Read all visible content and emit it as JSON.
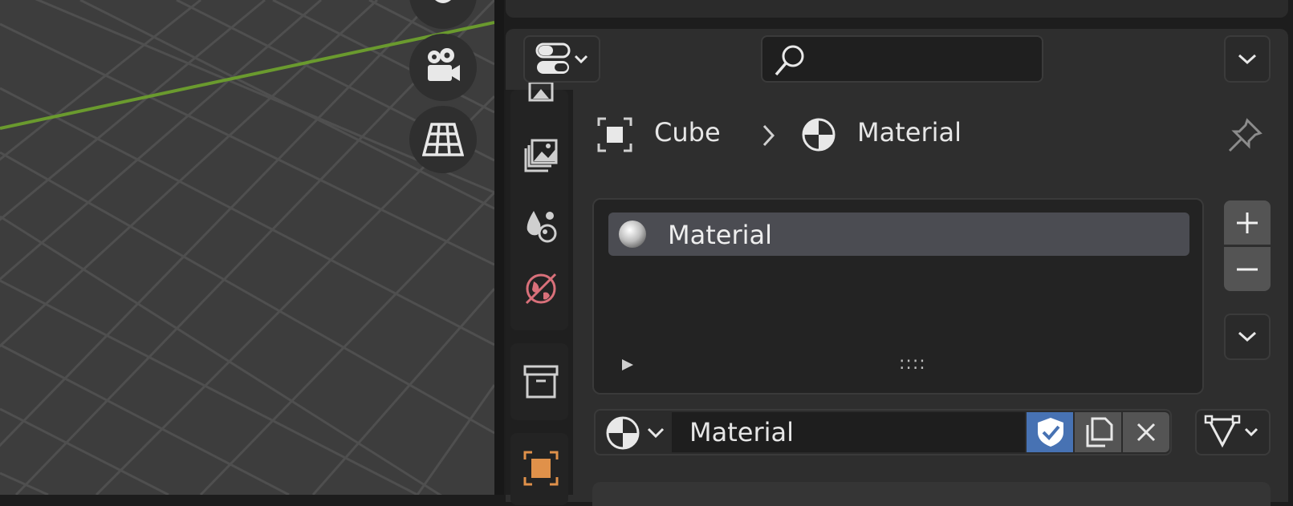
{
  "viewport": {
    "nav_icons": [
      "hand-pan-icon",
      "camera-icon",
      "perspective-grid-icon"
    ],
    "axis_color": "#6a9a2e"
  },
  "header": {
    "editor_type_icon": "toggle-editor-icon",
    "search_placeholder": "",
    "menu_icon": "chevron-down-icon"
  },
  "tabs": [
    "render-icon",
    "output-icon",
    "view-layer-icon",
    "scene-icon",
    "world-icon",
    "collection-icon",
    "object-icon"
  ],
  "breadcrumb": {
    "object_name": "Cube",
    "material_name": "Material"
  },
  "material_slots": {
    "items": [
      {
        "label": "Material"
      }
    ],
    "grip": "::::"
  },
  "material_browse": {
    "name": "Material",
    "accent_color": "#4772b3"
  }
}
